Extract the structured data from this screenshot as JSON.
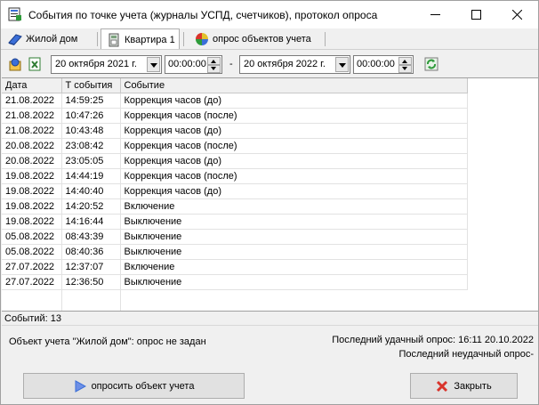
{
  "window": {
    "title": "События по точке учета (журналы УСПД, счетчиков), протокол опроса"
  },
  "tabs": [
    {
      "label": "Жилой дом",
      "icon": "house-icon"
    },
    {
      "label": "Квартира 1",
      "icon": "meter-icon",
      "active": true
    },
    {
      "label": "опрос объектов учета",
      "icon": "pie-chart-icon"
    }
  ],
  "toolbar": {
    "date_from": "20  октября  2021 г.",
    "time_from": "00:00:00",
    "separator": "-",
    "date_to": "20  октября  2022 г.",
    "time_to": "00:00:00"
  },
  "grid": {
    "columns": [
      "Дата",
      "Т события",
      "Событие"
    ],
    "rows": [
      [
        "21.08.2022",
        "14:59:25",
        "Коррекция часов (до)"
      ],
      [
        "21.08.2022",
        "10:47:26",
        "Коррекция часов (после)"
      ],
      [
        "21.08.2022",
        "10:43:48",
        "Коррекция часов (до)"
      ],
      [
        "20.08.2022",
        "23:08:42",
        "Коррекция часов (после)"
      ],
      [
        "20.08.2022",
        "23:05:05",
        "Коррекция часов (до)"
      ],
      [
        "19.08.2022",
        "14:44:19",
        "Коррекция часов (после)"
      ],
      [
        "19.08.2022",
        "14:40:40",
        "Коррекция часов (до)"
      ],
      [
        "19.08.2022",
        "14:20:52",
        "Включение"
      ],
      [
        "19.08.2022",
        "14:16:44",
        "Выключение"
      ],
      [
        "05.08.2022",
        "08:43:39",
        "Выключение"
      ],
      [
        "05.08.2022",
        "08:40:36",
        "Выключение"
      ],
      [
        "27.07.2022",
        "12:37:07",
        "Включение"
      ],
      [
        "27.07.2022",
        "12:36:50",
        "Выключение"
      ]
    ]
  },
  "status": {
    "count": "Событий: 13",
    "object": "Объект учета \"Жилой дом\": опрос не задан",
    "last_success": "Последний удачный опрос: 16:11 20.10.2022",
    "last_fail": "Последний неудачный опрос-"
  },
  "buttons": {
    "poll": "опросить объект учета",
    "close": "Закрыть"
  },
  "colors": {
    "accent_blue": "#3b6fd8",
    "close_red": "#d9342b",
    "refresh_green": "#2e9b3a"
  }
}
